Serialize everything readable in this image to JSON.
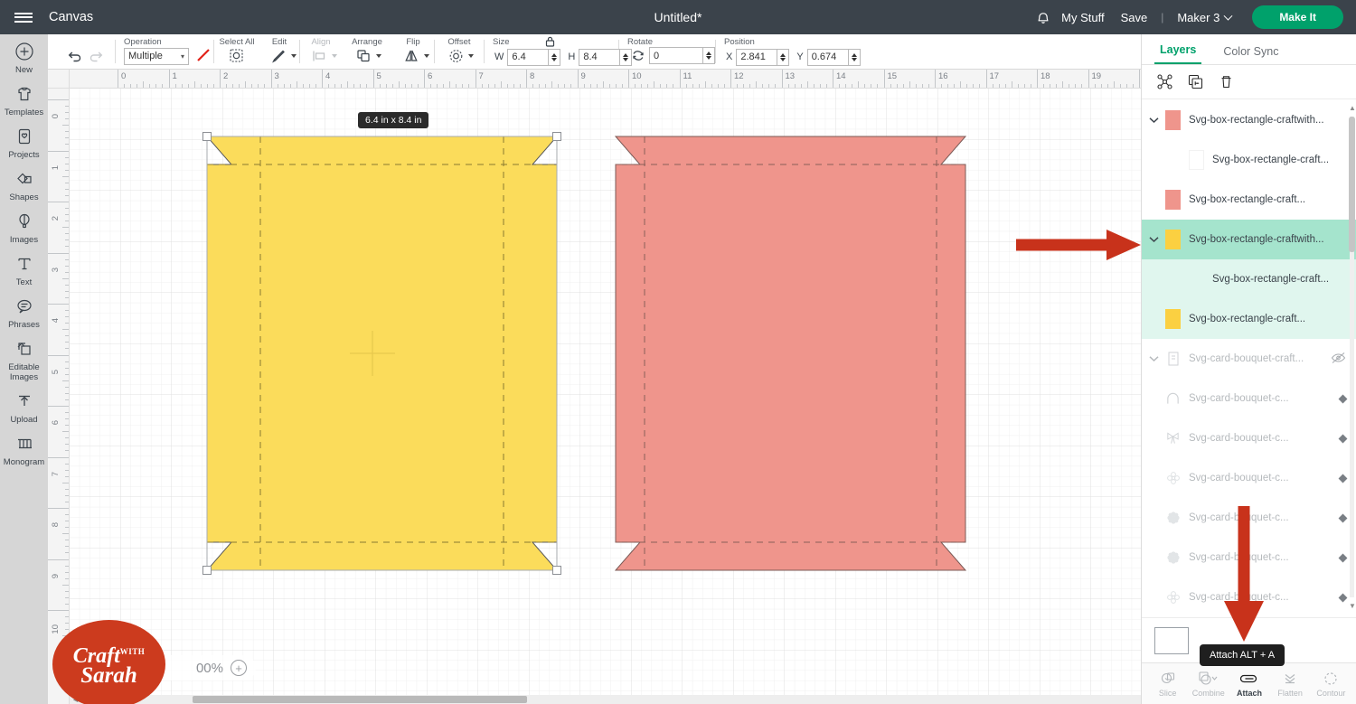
{
  "topbar": {
    "menu_icon": "hamburger-icon",
    "canvas_label": "Canvas",
    "doc_title": "Untitled*",
    "bell_icon": "notification-bell-icon",
    "my_stuff": "My Stuff",
    "save": "Save",
    "separator": "|",
    "machine": "Maker 3",
    "make_it": "Make It",
    "accent_green": "#00a16b",
    "bar_bg": "#3b434b"
  },
  "left_rail": [
    {
      "label": "New",
      "icon": "plus-circle-icon"
    },
    {
      "label": "Templates",
      "icon": "shirt-icon"
    },
    {
      "label": "Projects",
      "icon": "card-heart-icon"
    },
    {
      "label": "Shapes",
      "icon": "shapes-icon"
    },
    {
      "label": "Images",
      "icon": "hot-air-balloon-icon"
    },
    {
      "label": "Text",
      "icon": "text-t-icon"
    },
    {
      "label": "Phrases",
      "icon": "speech-bubble-icon"
    },
    {
      "label": "Editable Images",
      "icon": "editable-images-icon"
    },
    {
      "label": "Upload",
      "icon": "upload-arrow-icon"
    },
    {
      "label": "Monogram",
      "icon": "monogram-icon"
    }
  ],
  "toolbar": {
    "undo": "undo-icon",
    "redo": "redo-icon",
    "operation_label": "Operation",
    "operation_value": "Multiple",
    "operation_color": "#e2231a",
    "select_all_label": "Select All",
    "select_all_icon": "select-all-icon",
    "edit_label": "Edit",
    "edit_icon": "pencil-icon",
    "align_label": "Align",
    "align_icon": "align-icon",
    "arrange_label": "Arrange",
    "arrange_icon": "arrange-icon",
    "flip_label": "Flip",
    "flip_icon": "flip-icon",
    "offset_label": "Offset",
    "offset_icon": "offset-icon",
    "size_label": "Size",
    "lock_icon": "lock-closed-icon",
    "width_label": "W",
    "width_value": "6.4",
    "height_label": "H",
    "height_value": "8.4",
    "rotate_label": "Rotate",
    "rotate_icon": "rotate-icon",
    "rotate_value": "0",
    "position_label": "Position",
    "x_label": "X",
    "x_value": "2.841",
    "y_label": "Y",
    "y_value": "0.674"
  },
  "canvas": {
    "size_badge": "6.4  in x 8.4  in",
    "zoom_value": "00%",
    "zoom_in_icon": "plus-circle-icon",
    "h_ruler_max": 20,
    "v_ruler_max": 10,
    "unit": "in",
    "watermark": {
      "line1": "Craft",
      "with": "WITH",
      "line2": "Sarah",
      "color": "#cc3b1e"
    },
    "shapes": [
      {
        "name": "yellow-box-template",
        "fill": "#fbdc5b",
        "stroke": "#5a5a5a",
        "selected": true
      },
      {
        "name": "pink-box-template",
        "fill": "#ef958c",
        "stroke": "#7b5a56",
        "selected": false
      }
    ]
  },
  "right_panel": {
    "tabs": [
      {
        "label": "Layers",
        "active": true
      },
      {
        "label": "Color Sync",
        "active": false
      }
    ],
    "tools": [
      {
        "icon": "group-icon",
        "name": "group-button"
      },
      {
        "icon": "duplicate-icon",
        "name": "duplicate-button"
      },
      {
        "icon": "trash-icon",
        "name": "delete-button"
      }
    ],
    "layers": [
      {
        "name": "Svg-box-rectangle-craftwith...",
        "depth": 0,
        "swatch": "#ef958c",
        "expanded": true,
        "state": "normal",
        "icon": ""
      },
      {
        "name": "Svg-box-rectangle-craft...",
        "depth": 2,
        "swatch": "#ffffff",
        "expanded": false,
        "state": "normal",
        "icon": ""
      },
      {
        "name": "Svg-box-rectangle-craft...",
        "depth": 1,
        "swatch": "#ef958c",
        "expanded": false,
        "state": "normal",
        "icon": ""
      },
      {
        "name": "Svg-box-rectangle-craftwith...",
        "depth": 0,
        "swatch": "#fbd041",
        "expanded": true,
        "state": "selected",
        "icon": ""
      },
      {
        "name": "Svg-box-rectangle-craft...",
        "depth": 2,
        "swatch": "none",
        "expanded": false,
        "state": "child-selected",
        "icon": ""
      },
      {
        "name": "Svg-box-rectangle-craft...",
        "depth": 1,
        "swatch": "#fbd041",
        "expanded": false,
        "state": "child-selected",
        "icon": ""
      },
      {
        "name": "Svg-card-bouquet-craft...",
        "depth": 0,
        "swatch": "none",
        "expanded": true,
        "state": "hidden",
        "icon": "card-icon",
        "eye": "eye-off-icon"
      },
      {
        "name": "Svg-card-bouquet-c...",
        "depth": 1,
        "swatch": "none",
        "expanded": false,
        "state": "hidden",
        "icon": "arch-icon",
        "dot": true
      },
      {
        "name": "Svg-card-bouquet-c...",
        "depth": 1,
        "swatch": "none",
        "expanded": false,
        "state": "hidden",
        "icon": "bow-icon",
        "dot": true
      },
      {
        "name": "Svg-card-bouquet-c...",
        "depth": 1,
        "swatch": "none",
        "expanded": false,
        "state": "hidden",
        "icon": "flower-outline-icon",
        "dot": true
      },
      {
        "name": "Svg-card-bouquet-c...",
        "depth": 1,
        "swatch": "none",
        "expanded": false,
        "state": "hidden",
        "icon": "flower-solid-icon",
        "dot": true
      },
      {
        "name": "Svg-card-bouquet-c...",
        "depth": 1,
        "swatch": "none",
        "expanded": false,
        "state": "hidden",
        "icon": "flower-solid-icon",
        "dot": true
      },
      {
        "name": "Svg-card-bouquet-c...",
        "depth": 1,
        "swatch": "none",
        "expanded": false,
        "state": "hidden",
        "icon": "flower-outline-icon",
        "dot": true
      }
    ],
    "footer_color_label": "",
    "operations": [
      {
        "label": "Slice",
        "icon": "slice-icon",
        "enabled": false
      },
      {
        "label": "Combine",
        "icon": "combine-icon",
        "enabled": false,
        "caret": true
      },
      {
        "label": "Attach",
        "icon": "attach-icon",
        "enabled": true
      },
      {
        "label": "Flatten",
        "icon": "flatten-icon",
        "enabled": false
      },
      {
        "label": "Contour",
        "icon": "contour-icon",
        "enabled": false
      }
    ],
    "tooltip": "Attach ALT + A"
  },
  "annotations": {
    "arrow_color": "#c8321b",
    "left_arrow_target": "selected layer row",
    "down_arrow_target": "attach button"
  }
}
